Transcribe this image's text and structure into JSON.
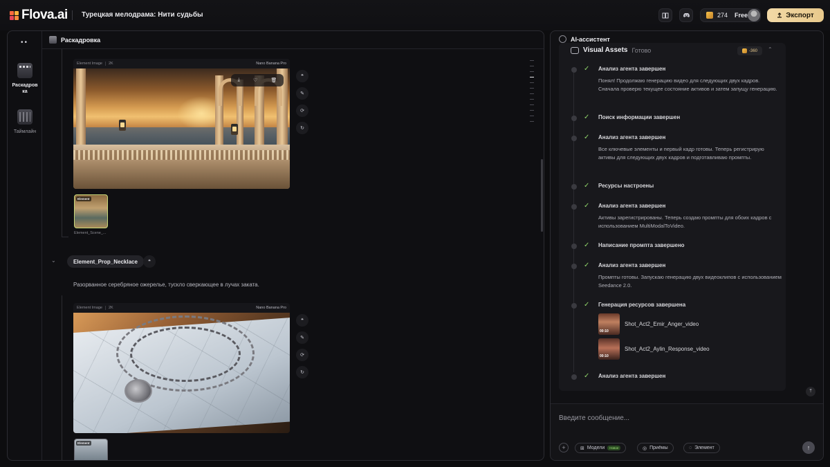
{
  "app": {
    "logo_text": "Flova.ai",
    "project_title": "Турецкая мелодрама: Нити судьбы",
    "credits": "274",
    "plan": "Free",
    "export_label": "Экспорт",
    "colors": {
      "accent": "#e8c98c",
      "success": "#8fd46a",
      "background": "#0d0d0f"
    }
  },
  "sidebar": {
    "items": [
      {
        "label": "Раскадровка",
        "icon": "storyboard-icon",
        "active": true
      },
      {
        "label": "Таймлайн",
        "icon": "timeline-icon",
        "active": false
      }
    ]
  },
  "storyboard": {
    "header_title": "Раскадровка",
    "scene": {
      "card_type": "Element Image",
      "resolution": "2K",
      "model": "Nano Banana Pro",
      "thumb_tag": "Element",
      "thumb_caption": "Element_Scene_..."
    },
    "prop": {
      "name": "Element_Prop_Necklace",
      "description": "Разорванное серебряное ожерелье, тускло сверкающее в лучах заката.",
      "card_type": "Element Image",
      "resolution": "2K",
      "model": "Nano Banana Pro",
      "thumb_tag": "Element"
    }
  },
  "assistant": {
    "header_title": "AI-ассистент",
    "visual_assets": {
      "title": "Visual Assets",
      "status": "Готово",
      "cost": "-360"
    },
    "steps": [
      {
        "title": "Анализ агента завершен",
        "body": "Понял! Продолжаю генерацию видео для следующих двух кадров. Сначала проверю текущее состояние активов и затем запущу генерацию."
      },
      {
        "title": "Поиск информации завершен",
        "body": ""
      },
      {
        "title": "Анализ агента завершен",
        "body": "Все ключевые элементы и первый кадр готовы. Теперь регистрирую активы для следующих двух кадров и подготавливаю промпты."
      },
      {
        "title": "Ресурсы настроены",
        "body": ""
      },
      {
        "title": "Анализ агента завершен",
        "body": "Активы зарегистрированы. Теперь создаю промпты для обоих кадров с использованием MultiModalToVideo."
      },
      {
        "title": "Написание промпта завершено",
        "body": ""
      },
      {
        "title": "Анализ агента завершен",
        "body": "Промпты готовы. Запускаю генерацию двух видеоклипов с использованием Seedance 2.0."
      },
      {
        "title": "Генерация ресурсов завершена",
        "body": ""
      },
      {
        "title": "Анализ агента завершен",
        "body": ""
      }
    ],
    "videos": [
      {
        "name": "Shot_Act2_Emir_Anger_video",
        "duration": "00:10"
      },
      {
        "name": "Shot_Act2_Aylin_Response_video",
        "duration": "00:10"
      }
    ],
    "input_placeholder": "Введите сообщение...",
    "pills": [
      {
        "label": "Модели",
        "badge": "Новое"
      },
      {
        "label": "Приёмы",
        "badge": ""
      },
      {
        "label": "Элемент",
        "badge": ""
      }
    ]
  }
}
